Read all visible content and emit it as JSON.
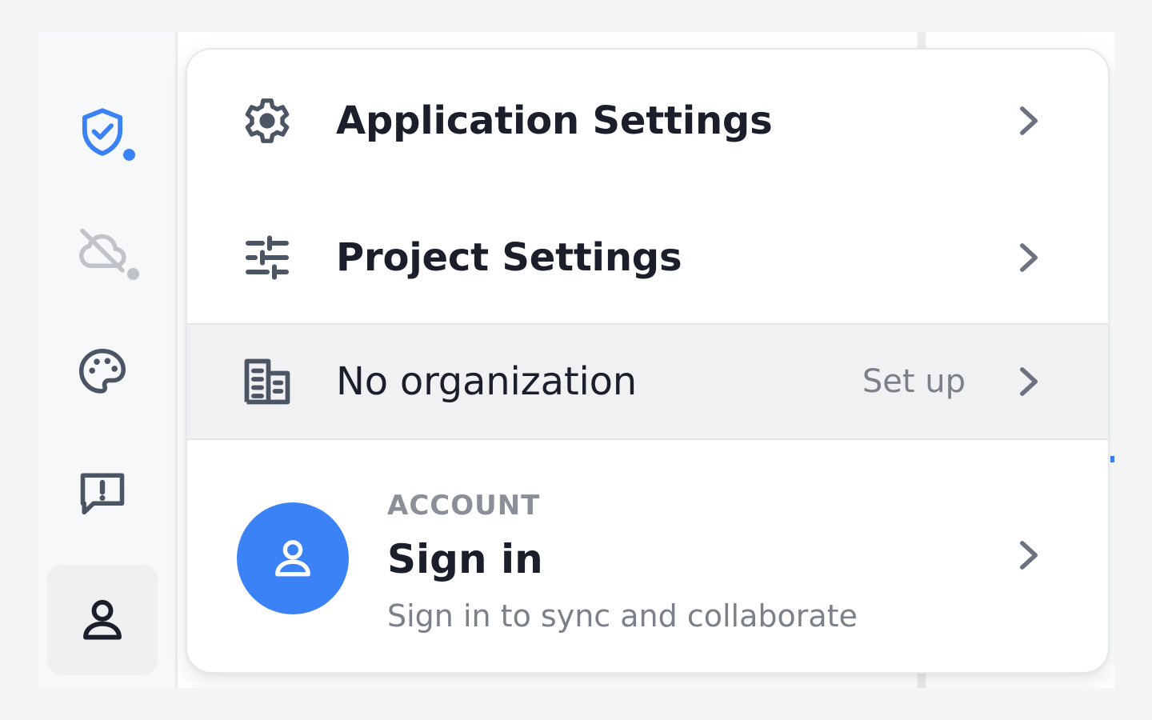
{
  "sidebar": {
    "items": [
      {
        "icon": "shield-check-icon",
        "status_dot": "blue"
      },
      {
        "icon": "cloud-off-icon",
        "status_dot": "gray"
      },
      {
        "icon": "palette-icon"
      },
      {
        "icon": "feedback-icon"
      },
      {
        "icon": "user-icon",
        "active": true
      }
    ]
  },
  "menu": {
    "application_settings": {
      "label": "Application Settings",
      "icon": "gear-icon"
    },
    "project_settings": {
      "label": "Project Settings",
      "icon": "sliders-icon"
    },
    "organization": {
      "label": "No organization",
      "action": "Set up",
      "icon": "building-icon"
    },
    "account": {
      "eyebrow": "ACCOUNT",
      "title": "Sign in",
      "subtitle": "Sign in to sync and collaborate",
      "icon": "user-icon"
    }
  },
  "colors": {
    "accent": "#3b82f6",
    "text_primary": "#1a1f2b",
    "text_muted": "#7b8089",
    "offline_dot": "#c0c3c8"
  }
}
